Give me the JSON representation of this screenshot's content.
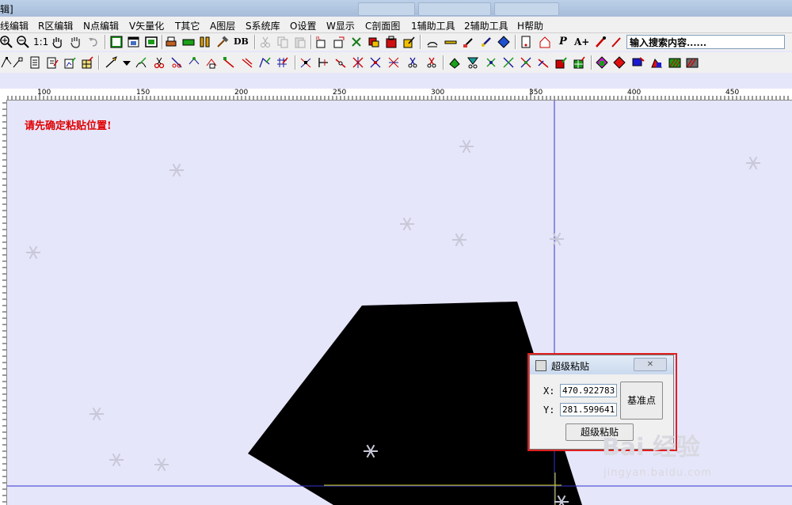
{
  "titlebar": {
    "title": "辑]"
  },
  "menu": [
    {
      "id": "line",
      "label": "线编辑"
    },
    {
      "id": "region",
      "label": "R区编辑"
    },
    {
      "id": "point",
      "label": "N点编辑"
    },
    {
      "id": "vector",
      "label": "V矢量化"
    },
    {
      "id": "other",
      "label": "T其它"
    },
    {
      "id": "layer",
      "label": "A图层"
    },
    {
      "id": "syslib",
      "label": "S系统库"
    },
    {
      "id": "settings",
      "label": "O设置"
    },
    {
      "id": "display",
      "label": "W显示"
    },
    {
      "id": "section",
      "label": "C剖面图"
    },
    {
      "id": "aux1",
      "label": "1辅助工具"
    },
    {
      "id": "aux2",
      "label": "2辅助工具"
    },
    {
      "id": "help",
      "label": "H帮助"
    }
  ],
  "toolbar": {
    "zoom_ratio": "1:1",
    "db_label": "DB",
    "text_p": "P",
    "text_a": "A+",
    "search_placeholder": "输入搜索内容......"
  },
  "ruler": {
    "ticks": [
      "100",
      "150",
      "200",
      "250",
      "300",
      "350",
      "400",
      "450"
    ]
  },
  "canvas": {
    "notice": "请先确定粘贴位置!"
  },
  "dialog": {
    "title": "超级粘贴",
    "x_label": "X:",
    "y_label": "Y:",
    "x_value": "470.922783",
    "y_value": "281.599641",
    "base_point_button": "基准点",
    "paste_button": "超级粘贴"
  },
  "watermark": {
    "brand": "Bai 经验",
    "url": "jingyan.baidu.com"
  },
  "colors": {
    "canvas_bg": "#e6e6fa",
    "notice": "#e00000",
    "crosshair": "#3333cc",
    "highlight": "#e02020"
  }
}
